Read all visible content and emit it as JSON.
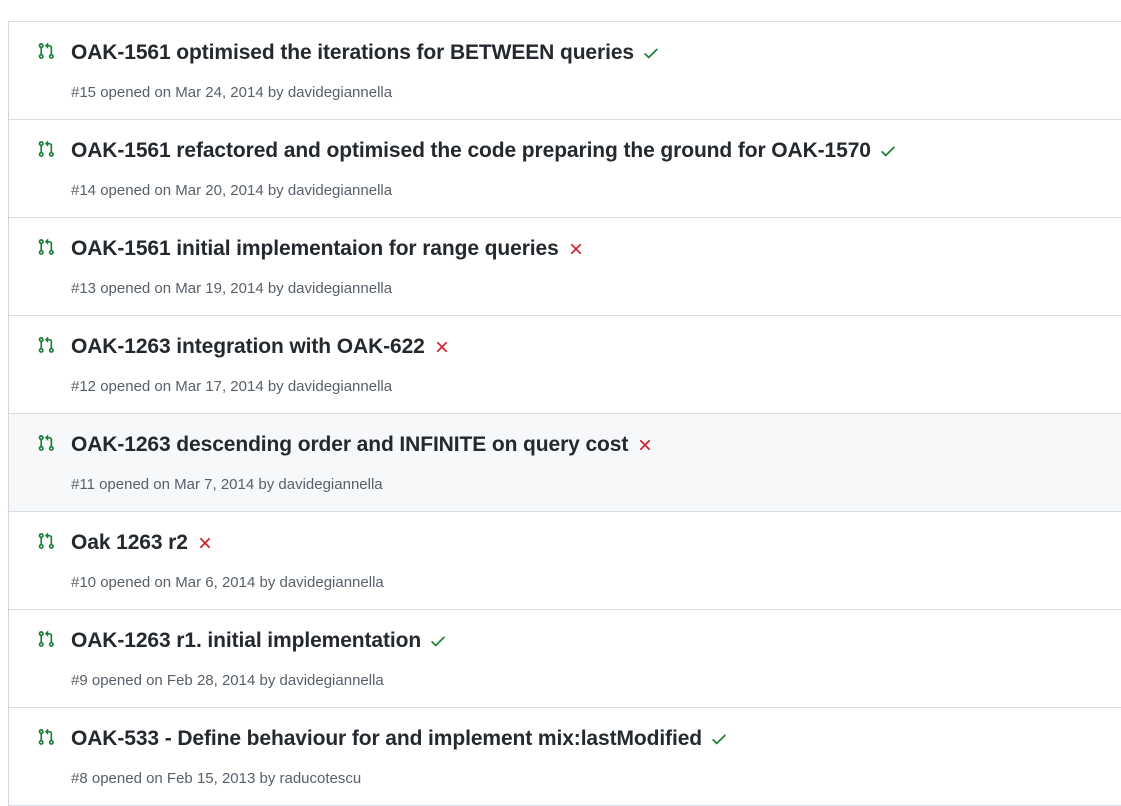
{
  "pull_requests": [
    {
      "title": "OAK-1561 optimised the iterations for BETWEEN queries",
      "meta": "#15 opened on Mar 24, 2014 by davidegiannella",
      "status": "success"
    },
    {
      "title": "OAK-1561 refactored and optimised the code preparing the ground for OAK-1570",
      "meta": "#14 opened on Mar 20, 2014 by davidegiannella",
      "status": "success"
    },
    {
      "title": "OAK-1561 initial implementaion for range queries",
      "meta": "#13 opened on Mar 19, 2014 by davidegiannella",
      "status": "failure"
    },
    {
      "title": "OAK-1263 integration with OAK-622",
      "meta": "#12 opened on Mar 17, 2014 by davidegiannella",
      "status": "failure"
    },
    {
      "title": "OAK-1263 descending order and INFINITE on query cost",
      "meta": "#11 opened on Mar 7, 2014 by davidegiannella",
      "status": "failure",
      "highlighted": true
    },
    {
      "title": "Oak 1263 r2",
      "meta": "#10 opened on Mar 6, 2014 by davidegiannella",
      "status": "failure"
    },
    {
      "title": "OAK-1263 r1. initial implementation",
      "meta": "#9 opened on Feb 28, 2014 by davidegiannella",
      "status": "success"
    },
    {
      "title": "OAK-533 - Define behaviour for and implement mix:lastModified",
      "meta": "#8 opened on Feb 15, 2013 by raducotescu",
      "status": "success"
    }
  ],
  "icons": {
    "pr": "git-pull-request-icon",
    "success": "check-icon",
    "failure": "x-icon"
  },
  "colors": {
    "pr_icon": "#1a7f37",
    "success": "#1a7f37",
    "failure": "#cf222e",
    "title": "#24292f",
    "meta": "#57606a",
    "highlight_bg": "#f6f8fa"
  }
}
